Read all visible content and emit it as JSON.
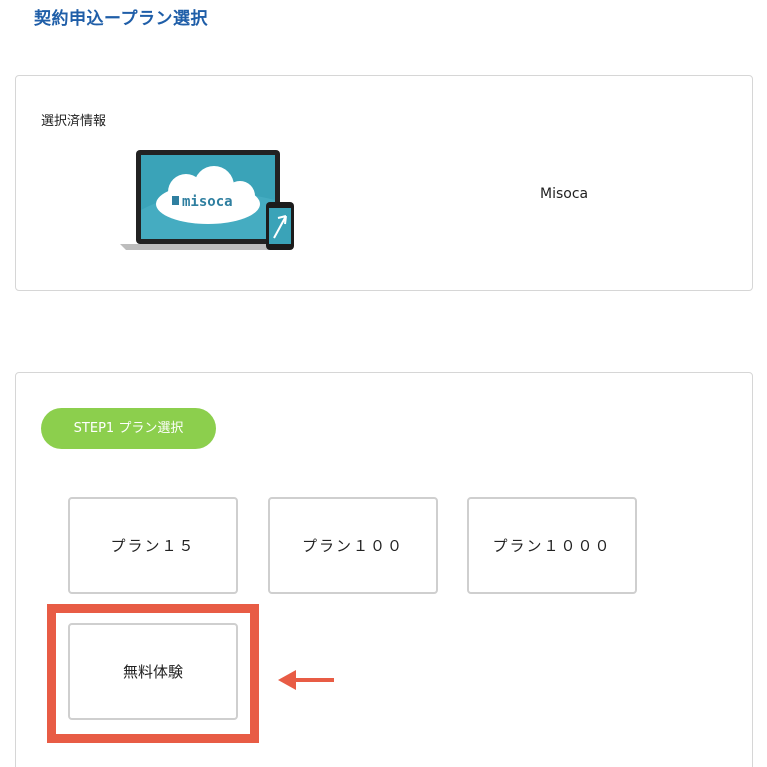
{
  "header": {
    "title": "契約申込ープラン選択"
  },
  "selected_info": {
    "label": "選択済情報",
    "product_name": "Misoca",
    "image_logo_text": "misoca"
  },
  "step1": {
    "badge": "STEP1  プラン選択",
    "plans": [
      {
        "label": "プラン１５"
      },
      {
        "label": "プラン１００"
      },
      {
        "label": "プラン１０００"
      },
      {
        "label": "無料体験"
      }
    ]
  },
  "colors": {
    "title": "#1f5ea8",
    "badge_green": "#8ccf4d",
    "highlight_red": "#e85c45",
    "screen_teal": "#3aa3b8"
  }
}
